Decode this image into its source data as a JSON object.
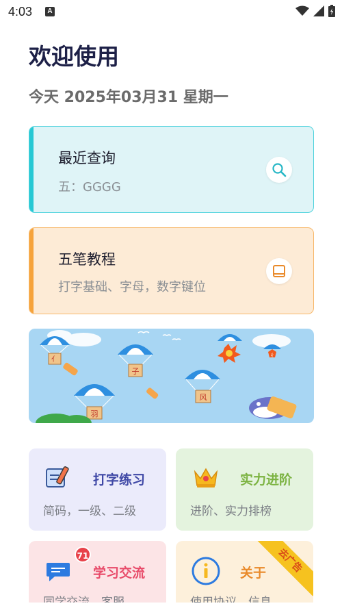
{
  "status_bar": {
    "time": "4:03",
    "notif_icon": "A"
  },
  "header": {
    "welcome": "欢迎使用",
    "date": "今天 2025年03月31 星期一"
  },
  "recent_card": {
    "title": "最近查询",
    "subtitle": "五：GGGG",
    "icon": "search-icon"
  },
  "tutorial_card": {
    "title": "五笔教程",
    "subtitle": "打字基础、字母，数字键位",
    "icon": "book-icon"
  },
  "banner": {
    "glyphs": [
      "亻",
      "子",
      "羽",
      "风",
      "彳"
    ]
  },
  "tiles": {
    "practice": {
      "title": "打字练习",
      "subtitle": "简码，一级、二级"
    },
    "level": {
      "title": "实力进阶",
      "subtitle": "进阶、实力排榜"
    },
    "community": {
      "title": "学习交流",
      "subtitle": "同学交流、客服",
      "badge": "71"
    },
    "about": {
      "title": "关于",
      "subtitle": "使用协议、信息",
      "ribbon": "去广告"
    }
  },
  "colors": {
    "title": "#1d2047",
    "cyan_accent": "#26c8d4",
    "orange_accent": "#f6a33b",
    "badge": "#e8424a"
  }
}
